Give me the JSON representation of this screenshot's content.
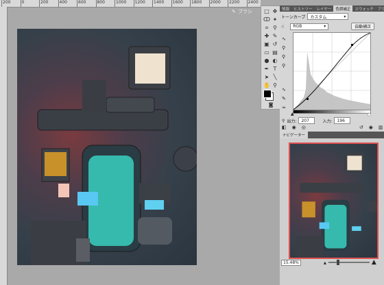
{
  "ruler": {
    "labels": [
      "200",
      "0",
      "200",
      "400",
      "600",
      "800",
      "1000",
      "1200",
      "1400",
      "1600",
      "1800",
      "2000",
      "2200",
      "2400"
    ]
  },
  "brush_panel": {
    "label": "ブラシ"
  },
  "panel_tabs": [
    "情報",
    "ヒストリー",
    "レイヤー",
    "色調補正",
    "スウォッチ",
    "アクション"
  ],
  "curves": {
    "preset_label": "トーンカーブ",
    "preset_value": "カスタム",
    "channel_value": "RGB",
    "auto_button": "自動補正",
    "output_label": "出力:",
    "output_value": "207",
    "input_label": "入力:",
    "input_value": "196"
  },
  "navigator": {
    "tab": "ナビゲーター",
    "zoom": "15.48%"
  },
  "colors": {
    "accent_red": "#e05050",
    "teal": "#38d0c0",
    "canvas_bg": "#a9a9a9"
  }
}
